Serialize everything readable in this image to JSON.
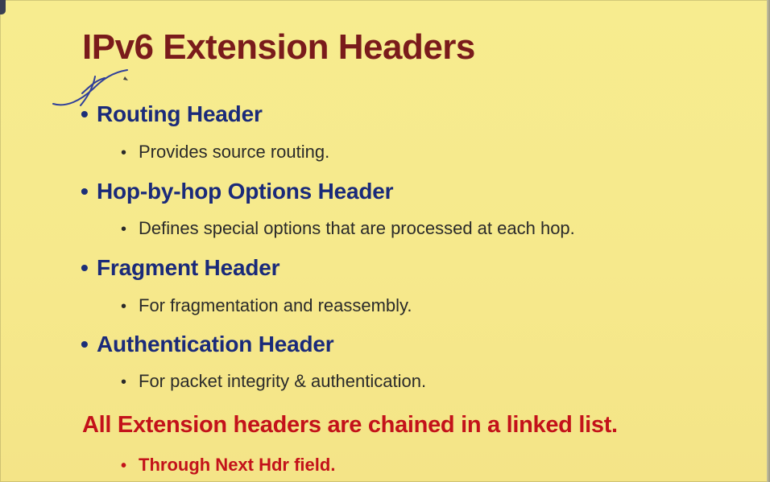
{
  "slide": {
    "title": "IPv6 Extension Headers",
    "items": [
      {
        "heading": "Routing Header",
        "detail": "Provides source routing."
      },
      {
        "heading": "Hop-by-hop Options Header",
        "detail": "Defines special options that are processed at each hop."
      },
      {
        "heading": "Fragment Header",
        "detail": "For fragmentation and reassembly."
      },
      {
        "heading": "Authentication Header",
        "detail": "For packet integrity & authentication."
      }
    ],
    "note": "All Extension headers are chained in a linked list.",
    "note_detail": "Through Next Hdr field.",
    "bullet": "•"
  },
  "colors": {
    "background": "#f6e98c",
    "title": "#7a1b1b",
    "heading": "#1a2a7a",
    "body": "#2a2a2a",
    "note": "#c3121a"
  }
}
